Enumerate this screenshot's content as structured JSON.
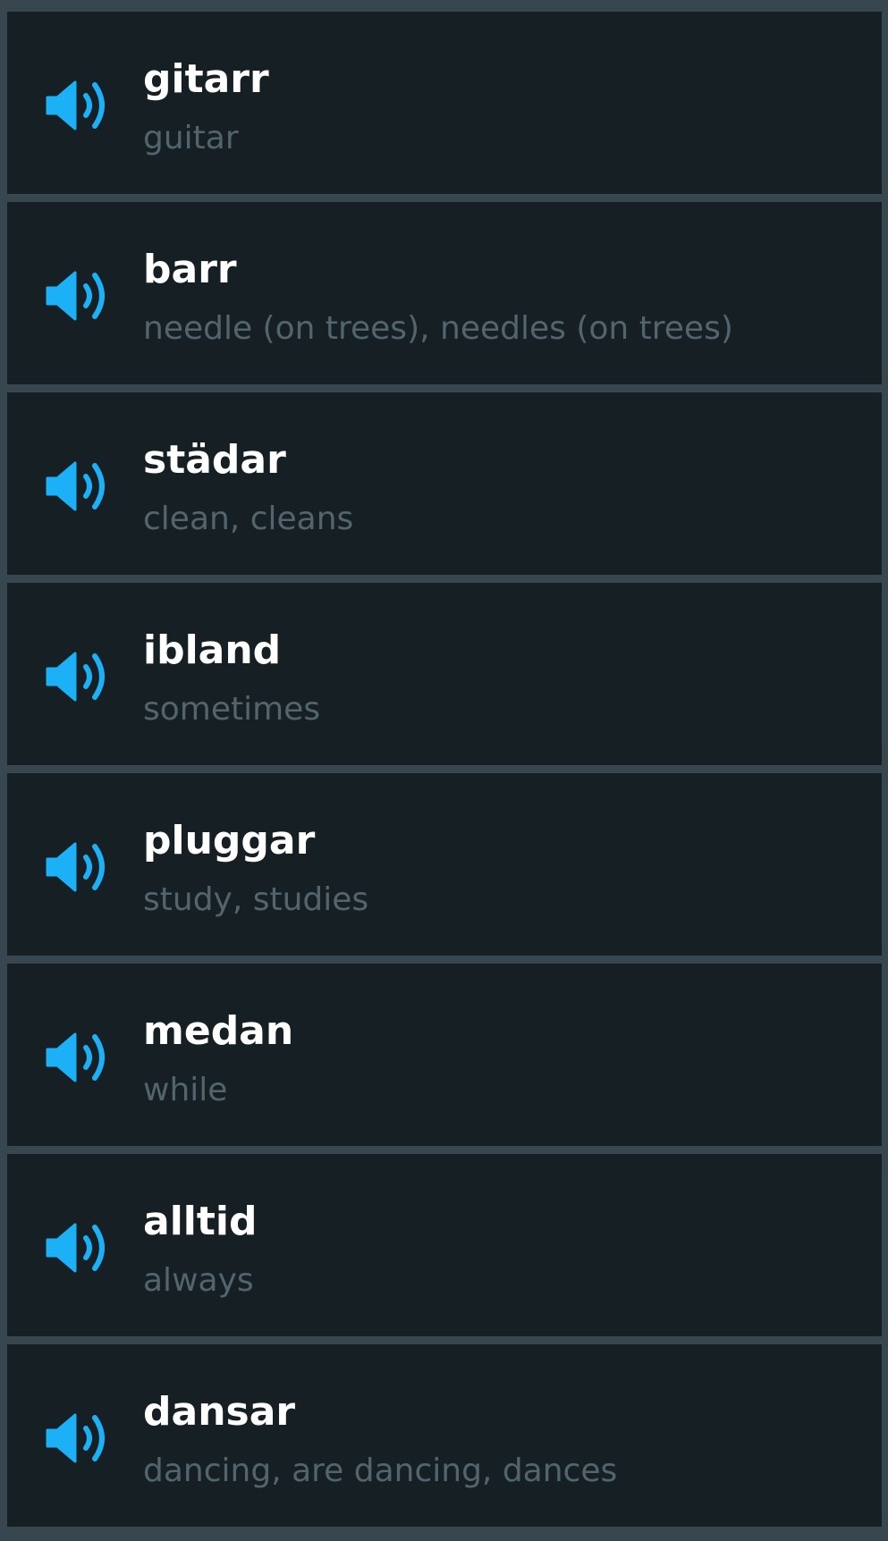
{
  "colors": {
    "background": "#151f24",
    "divider": "#37464f",
    "speaker_icon": "#1cb0f6",
    "word_text": "#ffffff",
    "meaning_text": "#52656d"
  },
  "words": [
    {
      "word": "gitarr",
      "meaning": "guitar",
      "icon": "speaker-icon"
    },
    {
      "word": "barr",
      "meaning": "needle (on trees), needles (on trees)",
      "icon": "speaker-icon"
    },
    {
      "word": "städar",
      "meaning": "clean, cleans",
      "icon": "speaker-icon"
    },
    {
      "word": "ibland",
      "meaning": "sometimes",
      "icon": "speaker-icon"
    },
    {
      "word": "pluggar",
      "meaning": "study, studies",
      "icon": "speaker-icon"
    },
    {
      "word": "medan",
      "meaning": "while",
      "icon": "speaker-icon"
    },
    {
      "word": "alltid",
      "meaning": "always",
      "icon": "speaker-icon"
    },
    {
      "word": "dansar",
      "meaning": "dancing, are dancing, dances",
      "icon": "speaker-icon"
    }
  ]
}
